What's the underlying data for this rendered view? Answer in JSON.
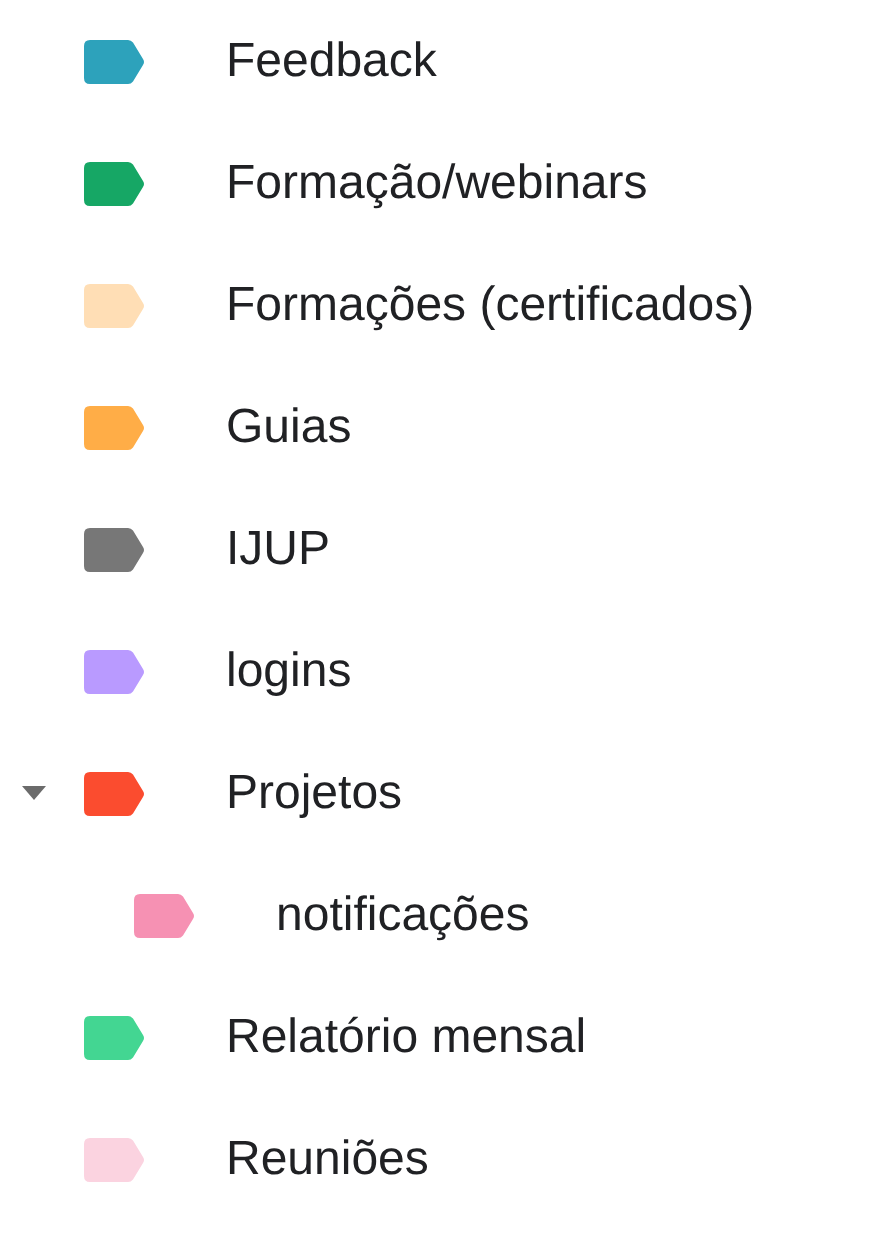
{
  "labels": [
    {
      "name": "Feedback",
      "color": "#2da2bb"
    },
    {
      "name": "Formação/webinars",
      "color": "#16a765"
    },
    {
      "name": "Formações (certificados)",
      "color": "#ffdeb5"
    },
    {
      "name": "Guias",
      "color": "#ffad47"
    },
    {
      "name": "IJUP",
      "color": "#777777"
    },
    {
      "name": "logins",
      "color": "#b99aff"
    },
    {
      "name": "Projetos",
      "color": "#fb4c2f",
      "expanded": true,
      "children": [
        {
          "name": "notificações",
          "color": "#f691b3"
        }
      ]
    },
    {
      "name": "Relatório mensal",
      "color": "#43d692"
    },
    {
      "name": "Reuniões",
      "color": "#fbd3e0"
    }
  ]
}
